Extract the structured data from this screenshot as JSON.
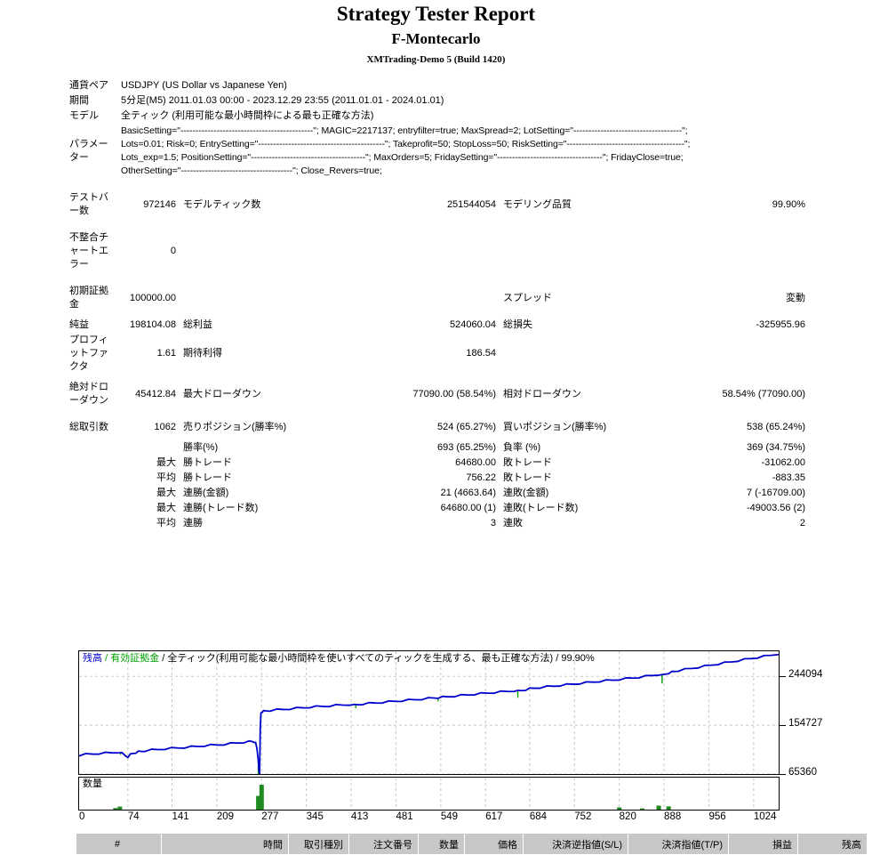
{
  "header": {
    "title": "Strategy Tester Report",
    "expert": "F-Montecarlo",
    "broker": "XMTrading-Demo 5 (Build 1420)"
  },
  "info": {
    "symbol_label": "通貨ペア",
    "symbol_value": "USDJPY (US Dollar vs Japanese Yen)",
    "period_label": "期間",
    "period_value": "5分足(M5) 2011.01.03 00:00 - 2023.12.29 23:55 (2011.01.01 - 2024.01.01)",
    "model_label": "モデル",
    "model_value": "全ティック (利用可能な最小時間枠による最も正確な方法)",
    "params_label": "パラメーター",
    "params_lines": [
      "BasicSetting=\"--------------------------------------------\"; MAGIC=2217137; entryfilter=true; MaxSpread=2; LotSetting=\"------------------------------------\";",
      "Lots=0.01; Risk=0; EntrySetting=\"------------------------------------------\"; Takeprofit=50; StopLoss=50; RiskSetting=\"---------------------------------------\";",
      "Lots_exp=1.5; PositionSetting=\"--------------------------------------\"; MaxOrders=5; FridaySetting=\"-----------------------------------\"; FridayClose=true;",
      "OtherSetting=\"-------------------------------------\"; Close_Revers=true;"
    ]
  },
  "stats": {
    "bars_label": "テストバー数",
    "bars_value": "972146",
    "ticks_label": "モデルティック数",
    "ticks_value": "251544054",
    "quality_label": "モデリング品質",
    "quality_value": "99.90%",
    "mismatch_label": "不整合チャートエラー",
    "mismatch_value": "0",
    "deposit_label": "初期証拠金",
    "deposit_value": "100000.00",
    "spread_label": "スプレッド",
    "spread_value": "変動",
    "netprofit_label": "純益",
    "netprofit_value": "198104.08",
    "grossprofit_label": "総利益",
    "grossprofit_value": "524060.04",
    "grossloss_label": "総損失",
    "grossloss_value": "-325955.96",
    "profitfactor_label": "プロフィットファクタ",
    "profitfactor_value": "1.61",
    "expected_label": "期待利得",
    "expected_value": "186.54",
    "abs_dd_label": "絶対ドローダウン",
    "abs_dd_value": "45412.84",
    "max_dd_label": "最大ドローダウン",
    "max_dd_value": "77090.00 (58.54%)",
    "rel_dd_label": "相対ドローダウン",
    "rel_dd_value": "58.54% (77090.00)"
  },
  "trades": {
    "total_label": "総取引数",
    "total_value": "1062",
    "short_label": "売りポジション(勝率%)",
    "short_value": "524 (65.27%)",
    "long_label": "買いポジション(勝率%)",
    "long_value": "538 (65.24%)",
    "win_label": "勝率(%)",
    "win_value": "693 (65.25%)",
    "loss_label": "負率 (%)",
    "loss_value": "369 (34.75%)",
    "max_prefix": "最大",
    "avg_prefix": "平均",
    "largest_win_label": "勝トレード",
    "largest_win_value": "64680.00",
    "largest_loss_label": "敗トレード",
    "largest_loss_value": "-31062.00",
    "avg_win_label": "勝トレード",
    "avg_win_value": "756.22",
    "avg_loss_label": "敗トレード",
    "avg_loss_value": "-883.35",
    "max_consec_win_label": "連勝(金額)",
    "max_consec_win_value": "21 (4663.64)",
    "max_consec_loss_label": "連敗(金額)",
    "max_consec_loss_value": "7 (-16709.00)",
    "max_consec_profit_label": "連勝(トレード数)",
    "max_consec_profit_value": "64680.00 (1)",
    "max_consec_lossamt_label": "連敗(トレード数)",
    "max_consec_lossamt_value": "-49003.56 (2)",
    "avg_consec_win_label": "連勝",
    "avg_consec_win_value": "3",
    "avg_consec_loss_label": "連敗",
    "avg_consec_loss_value": "2"
  },
  "chart_data": {
    "type": "line",
    "title": "",
    "legend": {
      "balance": "残高",
      "equity": "有効証拠金",
      "model": "全ティック(利用可能な最小時間枠を使いすべてのティックを生成する、最も正確な方法)",
      "quality": "99.90%",
      "sep": "/",
      "balance_color": "#0000cc",
      "equity_color": "#00a000"
    },
    "volume_label": "数量",
    "ylabel": "",
    "xlabel": "",
    "yticks": [
      "244094",
      "154727",
      "65360"
    ],
    "ytick_values": [
      244094,
      154727,
      65360
    ],
    "ylim": [
      65360,
      290000
    ],
    "xticks": [
      "0",
      "74",
      "141",
      "209",
      "277",
      "345",
      "413",
      "481",
      "549",
      "617",
      "684",
      "752",
      "820",
      "888",
      "956",
      "1024"
    ],
    "xtick_values": [
      0,
      74,
      141,
      209,
      277,
      345,
      413,
      481,
      549,
      617,
      684,
      752,
      820,
      888,
      956,
      1024
    ],
    "xlim": [
      0,
      1062
    ],
    "grid": true,
    "series": [
      {
        "name": "残高",
        "color": "#0000cc",
        "x": [
          0,
          10,
          20,
          30,
          40,
          50,
          60,
          65,
          70,
          74,
          78,
          82,
          86,
          90,
          95,
          100,
          110,
          120,
          130,
          140,
          150,
          160,
          170,
          180,
          190,
          200,
          210,
          220,
          230,
          240,
          250,
          258,
          263,
          266,
          268,
          270,
          272,
          273,
          274,
          275,
          276,
          277,
          278,
          280,
          285,
          290,
          300,
          310,
          320,
          330,
          340,
          350,
          360,
          370,
          380,
          390,
          400,
          410,
          418,
          424,
          430,
          440,
          450,
          460,
          470,
          480,
          490,
          500,
          510,
          520,
          530,
          540,
          545,
          552,
          560,
          570,
          580,
          590,
          600,
          610,
          620,
          630,
          640,
          650,
          660,
          666,
          672,
          678,
          684,
          690,
          700,
          710,
          720,
          730,
          740,
          750,
          760,
          770,
          780,
          790,
          800,
          810,
          820,
          830,
          840,
          850,
          860,
          870,
          880,
          885,
          890,
          895,
          900,
          905,
          910,
          920,
          930,
          940,
          950,
          960,
          970,
          980,
          990,
          1000,
          1010,
          1020,
          1030,
          1040,
          1050,
          1062
        ],
        "y": [
          100000,
          101500,
          102400,
          103300,
          104000,
          104600,
          105600,
          103500,
          99500,
          97300,
          101000,
          103500,
          105000,
          106200,
          107200,
          108200,
          109500,
          110600,
          111800,
          112600,
          113500,
          114300,
          115200,
          116300,
          117500,
          118300,
          119000,
          120000,
          121300,
          122500,
          123800,
          124800,
          125200,
          124500,
          122000,
          112000,
          92000,
          70000,
          66500,
          150000,
          176000,
          178500,
          179500,
          180200,
          181200,
          182000,
          183000,
          184000,
          185000,
          186000,
          187000,
          188000,
          188800,
          189500,
          190300,
          191200,
          192000,
          192800,
          191500,
          192500,
          193800,
          194800,
          195800,
          196800,
          197800,
          198800,
          199800,
          200800,
          201800,
          202800,
          203800,
          204800,
          205400,
          206200,
          207200,
          208300,
          209400,
          210500,
          211600,
          212700,
          213800,
          214800,
          215800,
          216900,
          218000,
          217000,
          218500,
          220000,
          221500,
          222800,
          224000,
          225200,
          226500,
          227800,
          229000,
          230200,
          231500,
          232800,
          234000,
          235200,
          236400,
          237600,
          238800,
          240000,
          241400,
          242800,
          244300,
          246000,
          247800,
          246000,
          248500,
          250500,
          252000,
          253500,
          255000,
          257000,
          259000,
          261000,
          263000,
          265000,
          267000,
          269000,
          271000,
          273000,
          275000,
          277000,
          279000,
          281000,
          283000,
          285500
        ]
      },
      {
        "name": "有効証拠金",
        "color": "#00a000",
        "x": [],
        "y": []
      }
    ],
    "volume_bars": {
      "color": "#1f8a1f",
      "x": [
        55,
        62,
        272,
        277,
        820,
        855,
        880,
        895
      ],
      "heights": [
        0.06,
        0.12,
        0.55,
        1.0,
        0.09,
        0.05,
        0.16,
        0.13
      ]
    }
  },
  "table": {
    "columns": [
      {
        "label": "#",
        "align": "center",
        "width": 96
      },
      {
        "label": "時間",
        "align": "right",
        "width": 143
      },
      {
        "label": "取引種別",
        "align": "right",
        "width": 68
      },
      {
        "label": "注文番号",
        "align": "right",
        "width": 78
      },
      {
        "label": "数量",
        "align": "right",
        "width": 52
      },
      {
        "label": "価格",
        "align": "right",
        "width": 66
      },
      {
        "label": "決済逆指値(S/L)",
        "align": "right",
        "width": 118
      },
      {
        "label": "決済指値(T/P)",
        "align": "right",
        "width": 113
      },
      {
        "label": "損益",
        "align": "right",
        "width": 78
      },
      {
        "label": "残高",
        "align": "right",
        "width": 78
      }
    ],
    "rows": []
  }
}
